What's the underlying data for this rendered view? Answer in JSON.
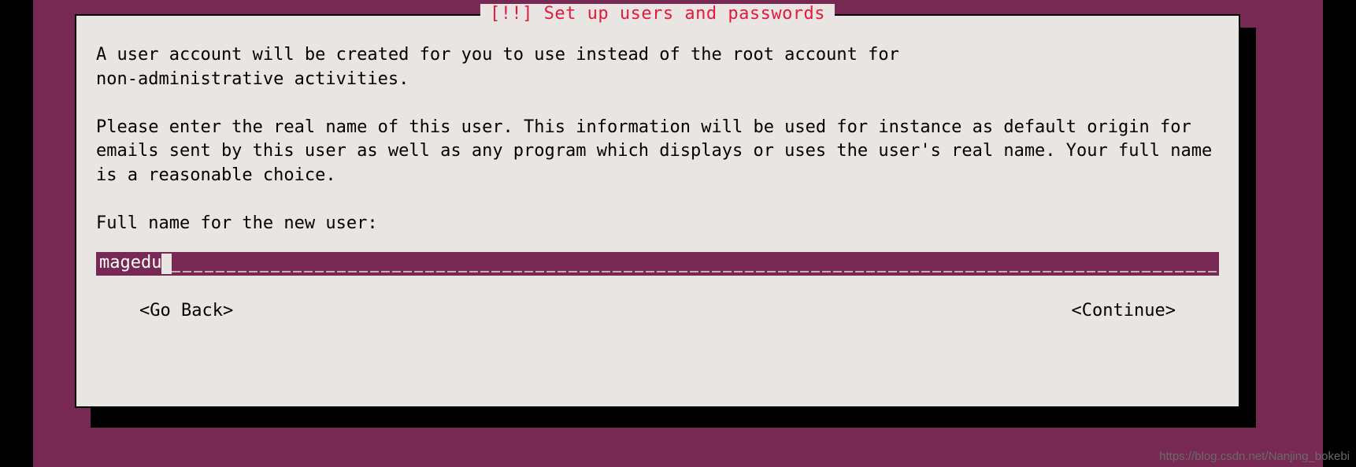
{
  "dialog": {
    "title": "[!!] Set up users and passwords",
    "para1": "A user account will be created for you to use instead of the root account for\nnon-administrative activities.",
    "para2": "Please enter the real name of this user. This information will be used for instance as default origin for emails sent by this user as well as any program which displays or uses the user's real name. Your full name is a reasonable choice.",
    "prompt": "Full name for the new user:",
    "input_value": "magedu",
    "go_back": "<Go Back>",
    "continue": "<Continue>"
  },
  "watermark": "https://blog.csdn.net/Nanjing_bokebi"
}
